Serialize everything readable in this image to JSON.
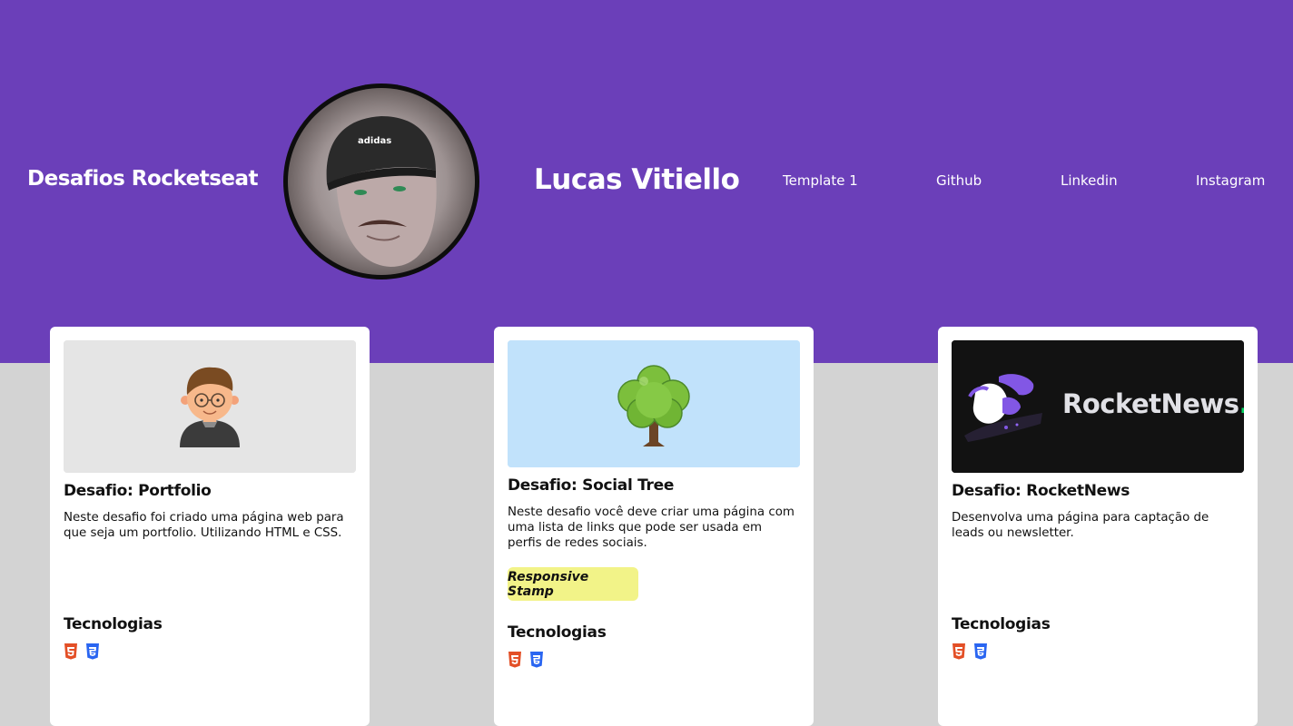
{
  "header": {
    "brand": "Desafios Rocketseat",
    "name": "Lucas Vitiello",
    "avatar_cap_text": "adidas",
    "nav": [
      {
        "label": "Template 1"
      },
      {
        "label": "Github"
      },
      {
        "label": "Linkedin"
      },
      {
        "label": "Instagram"
      }
    ]
  },
  "cards": [
    {
      "title": "Desafio: Portfolio",
      "description": "Neste desafio foi criado uma página web para que seja um portfolio. Utilizando HTML e CSS.",
      "tech_title": "Tecnologias",
      "tech_icons": [
        "html5-icon",
        "css3-icon"
      ]
    },
    {
      "title": "Desafio: Social Tree",
      "description": "Neste desafio você deve criar uma página com uma lista de links que pode ser usada em perfis de redes sociais.",
      "stamp": "Responsive Stamp",
      "tech_title": "Tecnologias",
      "tech_icons": [
        "html5-icon",
        "css3-icon"
      ]
    },
    {
      "title": "Desafio: RocketNews",
      "thumb_text": "RocketNews",
      "thumb_dot": ".",
      "description": "Desenvolva uma página para captação de leads ou newsletter.",
      "tech_title": "Tecnologias",
      "tech_icons": [
        "html5-icon",
        "css3-icon"
      ]
    }
  ],
  "colors": {
    "hero": "#6b3fb9",
    "page_bg": "#d3d3d3",
    "stamp": "#f2f388",
    "html5": "#e34f26",
    "css3": "#2965f1",
    "rocketnews_accent": "#04d361"
  }
}
